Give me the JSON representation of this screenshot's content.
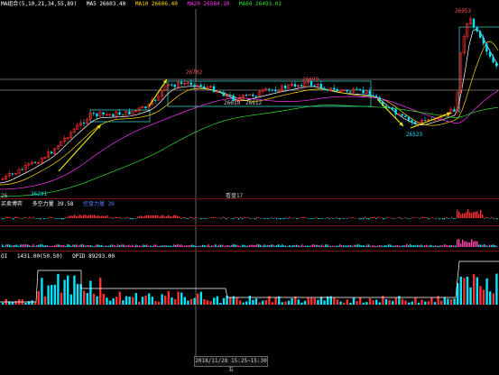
{
  "colors": {
    "bg": "#000000",
    "up": "#ff3030",
    "down": "#00e5ff",
    "ma5": "#ffffff",
    "ma10": "#ffd700",
    "ma20": "#ff33ff",
    "ma60": "#33dd33",
    "box": "#37c9c9",
    "arrow": "#e6e600",
    "separator": "#7a1010"
  },
  "header": {
    "indicator": "MA组合(5,10,21,34,55,89)",
    "ma5": "MA5 26603.40",
    "ma10": "MA10 26606.40",
    "ma20": "MA20 26584.10",
    "ma60": "MA60 26493.02"
  },
  "price_labels": {
    "high_right": "26953",
    "peak_left": "26702",
    "peak_mid": "26699",
    "low_mid": "26523",
    "low_left": "26291",
    "box_val_a": "26610",
    "box_val_b": "26612"
  },
  "main_panel": {
    "bottom_left": "26",
    "bottom_center": "看盘17"
  },
  "sub1": {
    "title": "买卖博弈",
    "mode": "多空力量 39.58",
    "series_label": "控盘力量 39"
  },
  "sub2": {
    "title": "OI",
    "value": "1431.00(50.50)",
    "opid": "OPID 89293.00"
  },
  "timebar": {
    "label": "2018/11/28 15:25~15:30 五"
  }
}
